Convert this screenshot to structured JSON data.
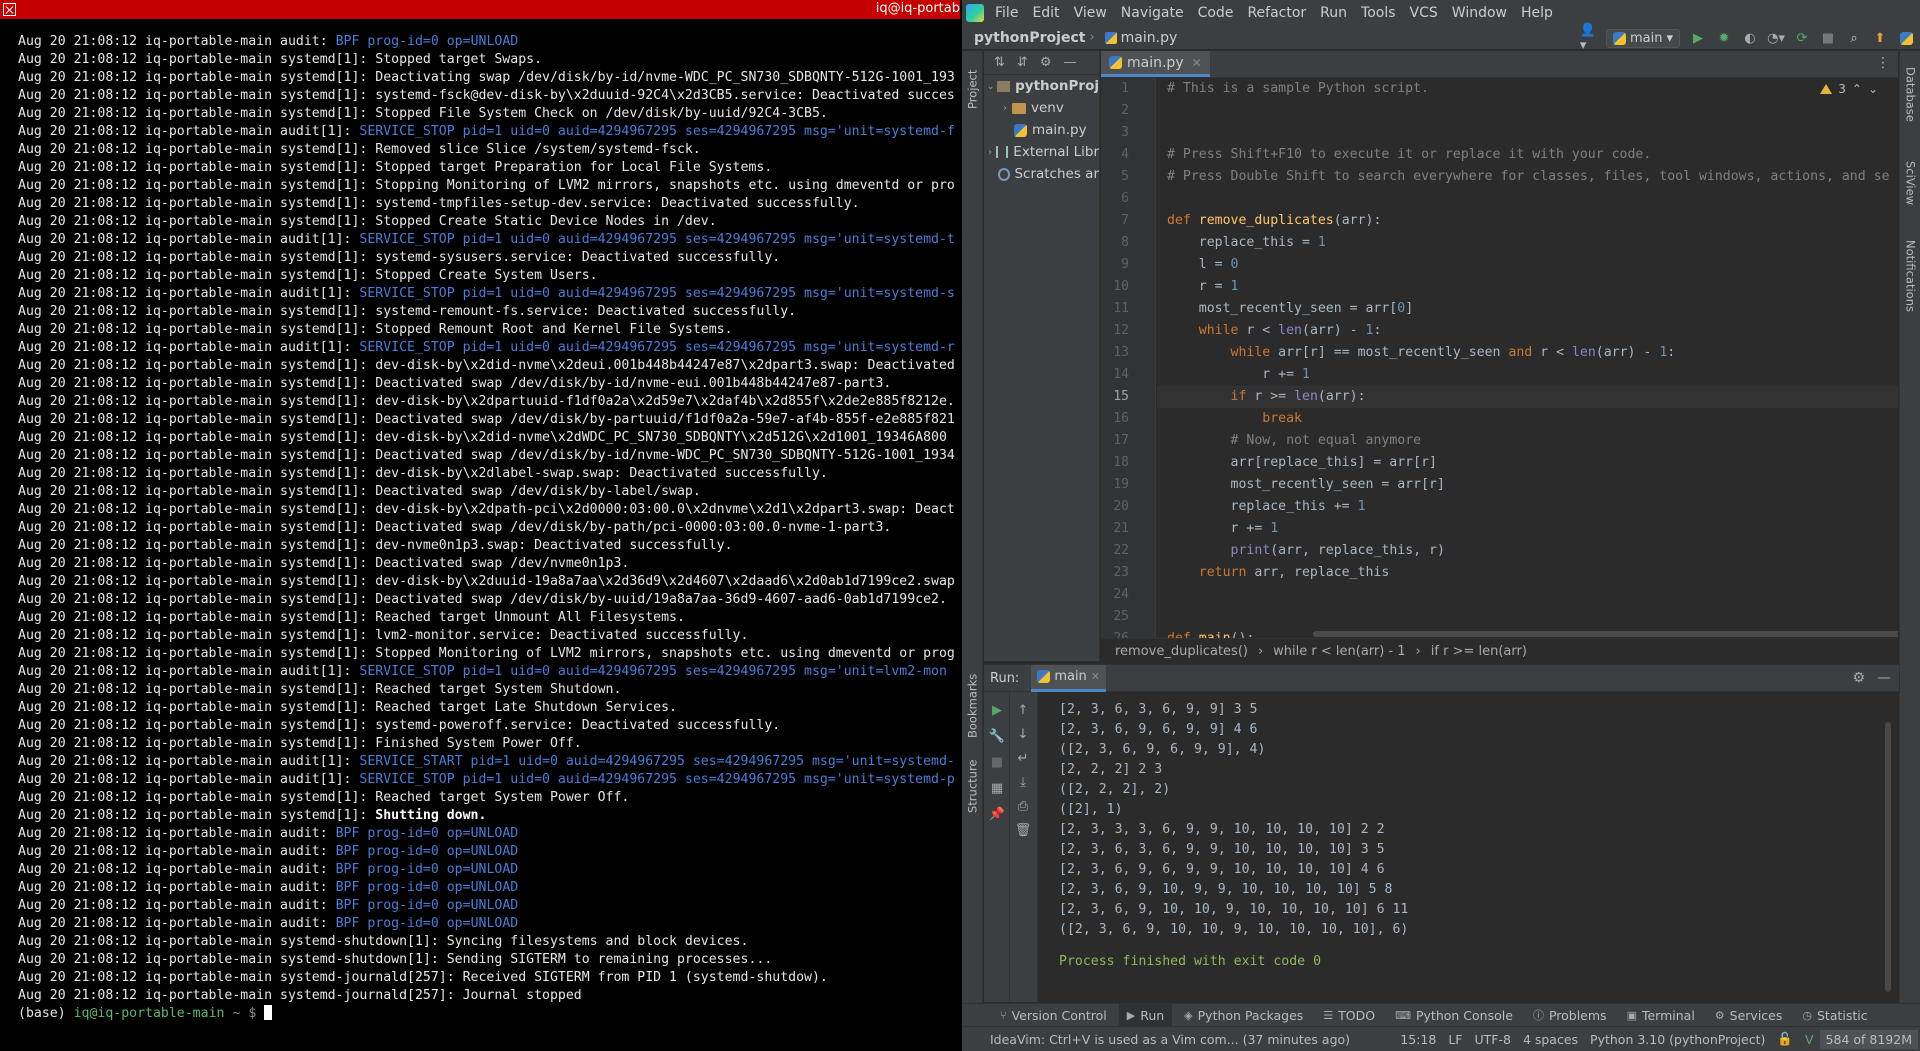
{
  "terminal": {
    "title": "iq@iq-portab",
    "prompt": {
      "env": "(base)",
      "user": "iq@iq-portable-main",
      "path": "~",
      "symbol": "$"
    },
    "lines": [
      {
        "p": "Aug 20 21:08:12 iq-portable-main audit: ",
        "h": "BPF prog-id=0 op=UNLOAD",
        "t": ""
      },
      {
        "p": "Aug 20 21:08:12 iq-portable-main systemd[1]: Stopped target Swaps.",
        "h": "",
        "t": ""
      },
      {
        "p": "Aug 20 21:08:12 iq-portable-main systemd[1]: Deactivating swap /dev/disk/by-id/nvme-WDC_PC_SN730_SDBQNTY-512G-1001_193",
        "h": "",
        "t": ""
      },
      {
        "p": "Aug 20 21:08:12 iq-portable-main systemd[1]: systemd-fsck@dev-disk-by\\x2duuid-92C4\\x2d3CB5.service: Deactivated succes",
        "h": "",
        "t": ""
      },
      {
        "p": "Aug 20 21:08:12 iq-portable-main systemd[1]: Stopped File System Check on /dev/disk/by-uuid/92C4-3CB5.",
        "h": "",
        "t": ""
      },
      {
        "p": "Aug 20 21:08:12 iq-portable-main audit[1]: ",
        "h": "SERVICE_STOP pid=1 uid=0 auid=4294967295 ses=4294967295 msg='unit=systemd-f",
        "t": ""
      },
      {
        "p": "Aug 20 21:08:12 iq-portable-main systemd[1]: Removed slice Slice /system/systemd-fsck.",
        "h": "",
        "t": ""
      },
      {
        "p": "Aug 20 21:08:12 iq-portable-main systemd[1]: Stopped target Preparation for Local File Systems.",
        "h": "",
        "t": ""
      },
      {
        "p": "Aug 20 21:08:12 iq-portable-main systemd[1]: Stopping Monitoring of LVM2 mirrors, snapshots etc. using dmeventd or pro",
        "h": "",
        "t": ""
      },
      {
        "p": "Aug 20 21:08:12 iq-portable-main systemd[1]: systemd-tmpfiles-setup-dev.service: Deactivated successfully.",
        "h": "",
        "t": ""
      },
      {
        "p": "Aug 20 21:08:12 iq-portable-main systemd[1]: Stopped Create Static Device Nodes in /dev.",
        "h": "",
        "t": ""
      },
      {
        "p": "Aug 20 21:08:12 iq-portable-main audit[1]: ",
        "h": "SERVICE_STOP pid=1 uid=0 auid=4294967295 ses=4294967295 msg='unit=systemd-t",
        "t": ""
      },
      {
        "p": "Aug 20 21:08:12 iq-portable-main systemd[1]: systemd-sysusers.service: Deactivated successfully.",
        "h": "",
        "t": ""
      },
      {
        "p": "Aug 20 21:08:12 iq-portable-main systemd[1]: Stopped Create System Users.",
        "h": "",
        "t": ""
      },
      {
        "p": "Aug 20 21:08:12 iq-portable-main audit[1]: ",
        "h": "SERVICE_STOP pid=1 uid=0 auid=4294967295 ses=4294967295 msg='unit=systemd-s",
        "t": ""
      },
      {
        "p": "Aug 20 21:08:12 iq-portable-main systemd[1]: systemd-remount-fs.service: Deactivated successfully.",
        "h": "",
        "t": ""
      },
      {
        "p": "Aug 20 21:08:12 iq-portable-main systemd[1]: Stopped Remount Root and Kernel File Systems.",
        "h": "",
        "t": ""
      },
      {
        "p": "Aug 20 21:08:12 iq-portable-main audit[1]: ",
        "h": "SERVICE_STOP pid=1 uid=0 auid=4294967295 ses=4294967295 msg='unit=systemd-r",
        "t": ""
      },
      {
        "p": "Aug 20 21:08:12 iq-portable-main systemd[1]: dev-disk-by\\x2did-nvme\\x2deui.001b448b44247e87\\x2dpart3.swap: Deactivated",
        "h": "",
        "t": ""
      },
      {
        "p": "Aug 20 21:08:12 iq-portable-main systemd[1]: Deactivated swap /dev/disk/by-id/nvme-eui.001b448b44247e87-part3.",
        "h": "",
        "t": ""
      },
      {
        "p": "Aug 20 21:08:12 iq-portable-main systemd[1]: dev-disk-by\\x2dpartuuid-f1df0a2a\\x2d59e7\\x2daf4b\\x2d855f\\x2de2e885f8212e.",
        "h": "",
        "t": ""
      },
      {
        "p": "Aug 20 21:08:12 iq-portable-main systemd[1]: Deactivated swap /dev/disk/by-partuuid/f1df0a2a-59e7-af4b-855f-e2e885f821",
        "h": "",
        "t": ""
      },
      {
        "p": "Aug 20 21:08:12 iq-portable-main systemd[1]: dev-disk-by\\x2did-nvme\\x2dWDC_PC_SN730_SDBQNTY\\x2d512G\\x2d1001_19346A800",
        "h": "",
        "t": ""
      },
      {
        "p": "Aug 20 21:08:12 iq-portable-main systemd[1]: Deactivated swap /dev/disk/by-id/nvme-WDC_PC_SN730_SDBQNTY-512G-1001_1934",
        "h": "",
        "t": ""
      },
      {
        "p": "Aug 20 21:08:12 iq-portable-main systemd[1]: dev-disk-by\\x2dlabel-swap.swap: Deactivated successfully.",
        "h": "",
        "t": ""
      },
      {
        "p": "Aug 20 21:08:12 iq-portable-main systemd[1]: Deactivated swap /dev/disk/by-label/swap.",
        "h": "",
        "t": ""
      },
      {
        "p": "Aug 20 21:08:12 iq-portable-main systemd[1]: dev-disk-by\\x2dpath-pci\\x2d0000:03:00.0\\x2dnvme\\x2d1\\x2dpart3.swap: Deact",
        "h": "",
        "t": ""
      },
      {
        "p": "Aug 20 21:08:12 iq-portable-main systemd[1]: Deactivated swap /dev/disk/by-path/pci-0000:03:00.0-nvme-1-part3.",
        "h": "",
        "t": ""
      },
      {
        "p": "Aug 20 21:08:12 iq-portable-main systemd[1]: dev-nvme0n1p3.swap: Deactivated successfully.",
        "h": "",
        "t": ""
      },
      {
        "p": "Aug 20 21:08:12 iq-portable-main systemd[1]: Deactivated swap /dev/nvme0n1p3.",
        "h": "",
        "t": ""
      },
      {
        "p": "Aug 20 21:08:12 iq-portable-main systemd[1]: dev-disk-by\\x2duuid-19a8a7aa\\x2d36d9\\x2d4607\\x2daad6\\x2d0ab1d7199ce2.swap",
        "h": "",
        "t": ""
      },
      {
        "p": "Aug 20 21:08:12 iq-portable-main systemd[1]: Deactivated swap /dev/disk/by-uuid/19a8a7aa-36d9-4607-aad6-0ab1d7199ce2.",
        "h": "",
        "t": ""
      },
      {
        "p": "Aug 20 21:08:12 iq-portable-main systemd[1]: Reached target Unmount All Filesystems.",
        "h": "",
        "t": ""
      },
      {
        "p": "Aug 20 21:08:12 iq-portable-main systemd[1]: lvm2-monitor.service: Deactivated successfully.",
        "h": "",
        "t": ""
      },
      {
        "p": "Aug 20 21:08:12 iq-portable-main systemd[1]: Stopped Monitoring of LVM2 mirrors, snapshots etc. using dmeventd or prog",
        "h": "",
        "t": ""
      },
      {
        "p": "Aug 20 21:08:12 iq-portable-main audit[1]: ",
        "h": "SERVICE_STOP pid=1 uid=0 auid=4294967295 ses=4294967295 msg='unit=lvm2-mon",
        "t": ""
      },
      {
        "p": "Aug 20 21:08:12 iq-portable-main systemd[1]: Reached target System Shutdown.",
        "h": "",
        "t": ""
      },
      {
        "p": "Aug 20 21:08:12 iq-portable-main systemd[1]: Reached target Late Shutdown Services.",
        "h": "",
        "t": ""
      },
      {
        "p": "Aug 20 21:08:12 iq-portable-main systemd[1]: systemd-poweroff.service: Deactivated successfully.",
        "h": "",
        "t": ""
      },
      {
        "p": "Aug 20 21:08:12 iq-portable-main systemd[1]: Finished System Power Off.",
        "h": "",
        "t": ""
      },
      {
        "p": "Aug 20 21:08:12 iq-portable-main audit[1]: ",
        "h": "SERVICE_START pid=1 uid=0 auid=4294967295 ses=4294967295 msg='unit=systemd-",
        "t": ""
      },
      {
        "p": "Aug 20 21:08:12 iq-portable-main audit[1]: ",
        "h": "SERVICE_STOP pid=1 uid=0 auid=4294967295 ses=4294967295 msg='unit=systemd-p",
        "t": ""
      },
      {
        "p": "Aug 20 21:08:12 iq-portable-main systemd[1]: Reached target System Power Off.",
        "h": "",
        "t": ""
      },
      {
        "p": "Aug 20 21:08:12 iq-portable-main systemd[1]: ",
        "h": "",
        "t": "",
        "b": "Shutting down."
      },
      {
        "p": "Aug 20 21:08:12 iq-portable-main audit: ",
        "h": "BPF prog-id=0 op=UNLOAD",
        "t": ""
      },
      {
        "p": "Aug 20 21:08:12 iq-portable-main audit: ",
        "h": "BPF prog-id=0 op=UNLOAD",
        "t": ""
      },
      {
        "p": "Aug 20 21:08:12 iq-portable-main audit: ",
        "h": "BPF prog-id=0 op=UNLOAD",
        "t": ""
      },
      {
        "p": "Aug 20 21:08:12 iq-portable-main audit: ",
        "h": "BPF prog-id=0 op=UNLOAD",
        "t": ""
      },
      {
        "p": "Aug 20 21:08:12 iq-portable-main audit: ",
        "h": "BPF prog-id=0 op=UNLOAD",
        "t": ""
      },
      {
        "p": "Aug 20 21:08:12 iq-portable-main audit: ",
        "h": "BPF prog-id=0 op=UNLOAD",
        "t": ""
      },
      {
        "p": "Aug 20 21:08:12 iq-portable-main systemd-shutdown[1]: Syncing filesystems and block devices.",
        "h": "",
        "t": ""
      },
      {
        "p": "Aug 20 21:08:12 iq-portable-main systemd-shutdown[1]: Sending SIGTERM to remaining processes...",
        "h": "",
        "t": ""
      },
      {
        "p": "Aug 20 21:08:12 iq-portable-main systemd-journald[257]: Received SIGTERM from PID 1 (systemd-shutdow).",
        "h": "",
        "t": ""
      },
      {
        "p": "Aug 20 21:08:12 iq-portable-main systemd-journald[257]: Journal stopped",
        "h": "",
        "t": ""
      }
    ]
  },
  "ide": {
    "menu": [
      "File",
      "Edit",
      "View",
      "Navigate",
      "Code",
      "Refactor",
      "Run",
      "Tools",
      "VCS",
      "Window",
      "Help"
    ],
    "nav": {
      "project": "pythonProject",
      "file": "main.py",
      "run_config": "main"
    },
    "project_panel": {
      "label": "Project",
      "root": "pythonProj",
      "items": [
        {
          "label": "venv",
          "kind": "folder"
        },
        {
          "label": "main.py",
          "kind": "file"
        },
        {
          "label": "External Libr",
          "kind": "lib"
        },
        {
          "label": "Scratches ar",
          "kind": "scratch"
        }
      ]
    },
    "editor": {
      "tab": "main.py",
      "inspection_count": "3",
      "current_line": 15,
      "lines": [
        [
          [
            "cm",
            "# This is a sample Python script."
          ]
        ],
        [],
        [],
        [
          [
            "cm",
            "# Press Shift+F10 to execute it or replace it with your code."
          ]
        ],
        [
          [
            "cm",
            "# Press Double Shift to search everywhere for classes, files, tool windows, actions, and se"
          ]
        ],
        [],
        [
          [
            "kw",
            "def "
          ],
          [
            "fn",
            "remove_duplicates"
          ],
          [
            "t",
            "(arr):"
          ]
        ],
        [
          [
            "t",
            "    replace_this = "
          ],
          [
            "num",
            "1"
          ]
        ],
        [
          [
            "t",
            "    l = "
          ],
          [
            "num",
            "0"
          ]
        ],
        [
          [
            "t",
            "    r = "
          ],
          [
            "num",
            "1"
          ]
        ],
        [
          [
            "t",
            "    most_recently_seen = arr["
          ],
          [
            "num",
            "0"
          ],
          [
            "t",
            "]"
          ]
        ],
        [
          [
            "t",
            "    "
          ],
          [
            "kw",
            "while "
          ],
          [
            "t",
            "r < "
          ],
          [
            "bi",
            "len"
          ],
          [
            "t",
            "(arr) - "
          ],
          [
            "num",
            "1"
          ],
          [
            "t",
            ":"
          ]
        ],
        [
          [
            "t",
            "        "
          ],
          [
            "kw",
            "while "
          ],
          [
            "t",
            "arr[r] == most_recently_seen "
          ],
          [
            "kw",
            "and "
          ],
          [
            "t",
            "r < "
          ],
          [
            "bi",
            "len"
          ],
          [
            "t",
            "(arr) - "
          ],
          [
            "num",
            "1"
          ],
          [
            "t",
            ":"
          ]
        ],
        [
          [
            "t",
            "            r += "
          ],
          [
            "num",
            "1"
          ]
        ],
        [
          [
            "t",
            "        "
          ],
          [
            "kw",
            "if "
          ],
          [
            "t",
            "r >= "
          ],
          [
            "bi",
            "len"
          ],
          [
            "t",
            "(arr):"
          ]
        ],
        [
          [
            "t",
            "            "
          ],
          [
            "kw",
            "break"
          ]
        ],
        [
          [
            "t",
            "        "
          ],
          [
            "cm",
            "# Now, not equal anymore"
          ]
        ],
        [
          [
            "t",
            "        arr[replace_this] = arr[r]"
          ]
        ],
        [
          [
            "t",
            "        most_recently_seen = arr[r]"
          ]
        ],
        [
          [
            "t",
            "        replace_this += "
          ],
          [
            "num",
            "1"
          ]
        ],
        [
          [
            "t",
            "        r += "
          ],
          [
            "num",
            "1"
          ]
        ],
        [
          [
            "t",
            "        "
          ],
          [
            "bi",
            "print"
          ],
          [
            "t",
            "(arr, replace_this, r)"
          ]
        ],
        [
          [
            "t",
            "    "
          ],
          [
            "kw",
            "return "
          ],
          [
            "t",
            "arr, replace_this"
          ]
        ],
        [],
        [],
        [
          [
            "kw",
            "def "
          ],
          [
            "fn",
            "main"
          ],
          [
            "t",
            "():"
          ]
        ]
      ]
    },
    "breadcrumbs": [
      "remove_duplicates()",
      "while r < len(arr) - 1",
      "if r >= len(arr)"
    ],
    "run": {
      "label": "Run:",
      "tab": "main",
      "output": [
        "[2, 3, 6, 3, 6, 9, 9] 3 5",
        "[2, 3, 6, 9, 6, 9, 9] 4 6",
        "([2, 3, 6, 9, 6, 9, 9], 4)",
        "[2, 2, 2] 2 3",
        "([2, 2, 2], 2)",
        "([2], 1)",
        "[2, 3, 3, 3, 6, 9, 9, 10, 10, 10, 10] 2 2",
        "[2, 3, 6, 3, 6, 9, 9, 10, 10, 10, 10] 3 5",
        "[2, 3, 6, 9, 6, 9, 9, 10, 10, 10, 10] 4 6",
        "[2, 3, 6, 9, 10, 9, 9, 10, 10, 10, 10] 5 8",
        "[2, 3, 6, 9, 10, 10, 9, 10, 10, 10, 10] 6 11",
        "([2, 3, 6, 9, 10, 10, 9, 10, 10, 10, 10], 6)",
        "",
        "Process finished with exit code 0"
      ]
    },
    "left_stripe": [
      "Project",
      "Bookmarks",
      "Structure"
    ],
    "right_stripe": [
      "Database",
      "SciView",
      "Notifications"
    ],
    "tool_tabs": [
      {
        "label": "Version Control",
        "icon": "branch-icon"
      },
      {
        "label": "Run",
        "icon": "play-icon",
        "active": true
      },
      {
        "label": "Python Packages",
        "icon": "layers-icon"
      },
      {
        "label": "TODO",
        "icon": "list-icon"
      },
      {
        "label": "Python Console",
        "icon": "console-icon"
      },
      {
        "label": "Problems",
        "icon": "info-icon"
      },
      {
        "label": "Terminal",
        "icon": "terminal-icon"
      },
      {
        "label": "Services",
        "icon": "services-icon"
      },
      {
        "label": "Statistic",
        "icon": "clock-icon"
      }
    ],
    "status": {
      "message": "IdeaVim: Ctrl+V is used as a Vim com... (37 minutes ago)",
      "position": "15:18",
      "line_sep": "LF",
      "encoding": "UTF-8",
      "indent": "4 spaces",
      "interpreter": "Python 3.10 (pythonProject)",
      "memory": "584 of 8192M"
    }
  }
}
